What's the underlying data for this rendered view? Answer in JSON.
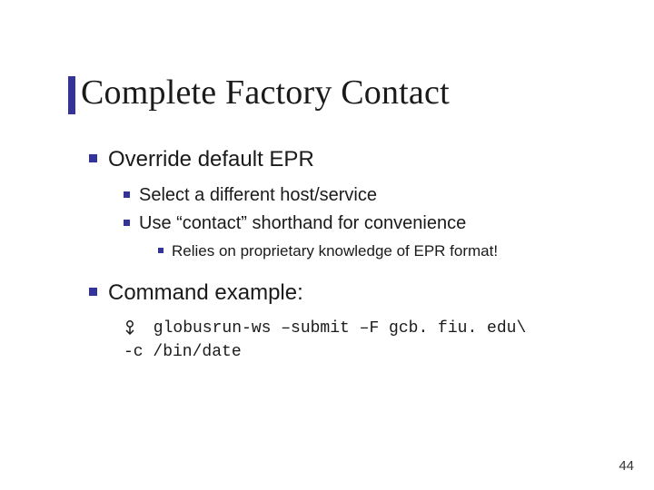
{
  "title": "Complete Factory Contact",
  "bullets": {
    "b1": "Override default EPR",
    "b1_sub": {
      "s1": "Select a different host/service",
      "s2": "Use “contact” shorthand for convenience",
      "s2_sub": {
        "t1": "Relies on proprietary knowledge of EPR format!"
      }
    },
    "b2": "Command example:",
    "b2_cmd_line1": " globusrun-ws –submit –F gcb. fiu. edu\\",
    "b2_cmd_line2": "-c /bin/date"
  },
  "page_number": "44"
}
